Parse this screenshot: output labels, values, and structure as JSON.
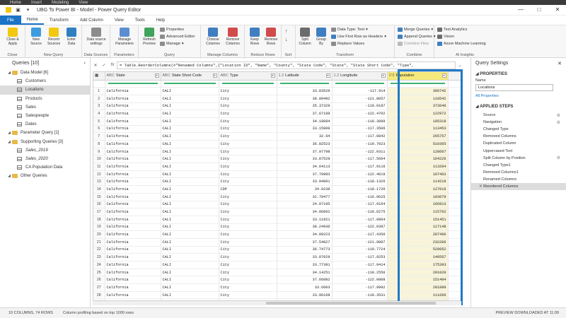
{
  "pbi_menu": [
    "Home",
    "Insert",
    "Modeling",
    "View"
  ],
  "title": "UBG To Power BI - Model - Power Query Editor",
  "tabs": [
    "File",
    "Home",
    "Transform",
    "Add Column",
    "View",
    "Tools",
    "Help"
  ],
  "active_tab": "Home",
  "ribbon": {
    "close": {
      "label": "Close &\nApply",
      "group": "Close"
    },
    "new_query": {
      "new_source": "New\nSource",
      "recent_sources": "Recent\nSources",
      "enter_data": "Enter\nData",
      "group": "New Query"
    },
    "data_sources": {
      "label": "Data source\nsettings",
      "group": "Data Sources"
    },
    "parameters": {
      "label": "Manage\nParameters",
      "group": "Parameters"
    },
    "query": {
      "refresh": "Refresh\nPreview",
      "properties": "Properties",
      "advanced_editor": "Advanced Editor",
      "manage": "Manage",
      "group": "Query"
    },
    "manage_columns": {
      "choose": "Choose\nColumns",
      "remove": "Remove\nColumns",
      "group": "Manage Columns"
    },
    "reduce_rows": {
      "keep": "Keep\nRows",
      "remove": "Remove\nRows",
      "group": "Reduce Rows"
    },
    "sort": {
      "group": "Sort"
    },
    "transform": {
      "split": "Split\nColumn",
      "group_by": "Group\nBy",
      "data_type": "Data Type: Text",
      "first_row": "Use First Row as Headers",
      "replace": "Replace Values",
      "group": "Transform"
    },
    "combine": {
      "merge": "Merge Queries",
      "append": "Append Queries",
      "combine_files": "Combine Files",
      "group": "Combine"
    },
    "ai": {
      "text_analytics": "Text Analytics",
      "vision": "Vision",
      "azure_ml": "Azure Machine Learning",
      "group": "AI Insights"
    }
  },
  "queries": {
    "header": "Queries [10]",
    "items": [
      {
        "label": "Data Model [6]",
        "kind": "folder",
        "indent": 0
      },
      {
        "label": "Customers",
        "kind": "table",
        "indent": 1
      },
      {
        "label": "Locations",
        "kind": "table",
        "indent": 1,
        "selected": true
      },
      {
        "label": "Products",
        "kind": "table",
        "indent": 1
      },
      {
        "label": "Sales",
        "kind": "table",
        "indent": 1
      },
      {
        "label": "Salespeople",
        "kind": "table",
        "indent": 1
      },
      {
        "label": "Dates",
        "kind": "table",
        "indent": 1
      },
      {
        "label": "Parameter Query [1]",
        "kind": "folder",
        "indent": 0
      },
      {
        "label": "Supporting Queries [3]",
        "kind": "folder",
        "indent": 0
      },
      {
        "label": "Sales_2019",
        "kind": "table",
        "indent": 1,
        "italic": true
      },
      {
        "label": "Sales_2020",
        "kind": "table",
        "indent": 1,
        "italic": true
      },
      {
        "label": "CA Population Data",
        "kind": "table",
        "indent": 1
      },
      {
        "label": "Other Queries",
        "kind": "folder",
        "indent": 0
      }
    ]
  },
  "formula": "= Table.ReorderColumns(#\"Renamed Columns\",{\"Location ID\", \"Name\", \"County\", \"State Code\", \"State\", \"State Short Code\", \"Type\",",
  "columns": [
    {
      "name": "State",
      "type": "ABC"
    },
    {
      "name": "State Short Code",
      "type": "ABC"
    },
    {
      "name": "Type",
      "type": "ABC"
    },
    {
      "name": "Latitude",
      "type": "1.2"
    },
    {
      "name": "Longitude",
      "type": "1.2"
    },
    {
      "name": "Population",
      "type": "1²3"
    }
  ],
  "rows": [
    [
      "California",
      "CALI",
      "City",
      "33.83529",
      "-117.914",
      "360742"
    ],
    [
      "California",
      "CALI",
      "City",
      "38.00492",
      "-121.8057",
      "110542"
    ],
    [
      "California",
      "CALI",
      "City",
      "35.37329",
      "-119.0187",
      "373640"
    ],
    [
      "California",
      "CALI",
      "City",
      "37.67189",
      "-122.4702",
      "122972"
    ],
    [
      "California",
      "CALI",
      "City",
      "34.18084",
      "-118.3089",
      "105319"
    ],
    [
      "California",
      "CALI",
      "City",
      "33.15809",
      "-117.3506",
      "113453"
    ],
    [
      "California",
      "CALI",
      "City",
      "32.64",
      "-117.0842",
      "265757"
    ],
    [
      "California",
      "CALI",
      "City",
      "36.82523",
      "-119.7023",
      "510365"
    ],
    [
      "California",
      "CALI",
      "City",
      "37.97798",
      "-122.0311",
      "128667"
    ],
    [
      "California",
      "CALI",
      "City",
      "33.87529",
      "-117.5664",
      "164226"
    ],
    [
      "California",
      "CALI",
      "City",
      "34.64113",
      "-117.9116",
      "113204"
    ],
    [
      "California",
      "CALI",
      "City",
      "37.70883",
      "-122.4619",
      "107463"
    ],
    [
      "California",
      "CALI",
      "City",
      "33.94001",
      "-118.1326",
      "114219"
    ],
    [
      "California",
      "CALI",
      "CDP",
      "34.0238",
      "-118.1720",
      "127016"
    ],
    [
      "California",
      "CALI",
      "City",
      "32.79477",
      "-116.9625",
      "103679"
    ],
    [
      "California",
      "CALI",
      "City",
      "34.07195",
      "-117.9164",
      "166913"
    ],
    [
      "California",
      "CALI",
      "City",
      "34.06862",
      "-118.0275",
      "115762"
    ],
    [
      "California",
      "CALI",
      "City",
      "33.11921",
      "-117.0864",
      "151451"
    ],
    [
      "California",
      "CALI",
      "City",
      "38.24936",
      "-122.0397",
      "117149"
    ],
    [
      "California",
      "CALI",
      "City",
      "34.09223",
      "-117.4350",
      "207460"
    ],
    [
      "California",
      "CALI",
      "City",
      "37.54827",
      "-121.9887",
      "232206"
    ],
    [
      "California",
      "CALI",
      "City",
      "36.74773",
      "-119.7724",
      "520052"
    ],
    [
      "California",
      "CALI",
      "City",
      "33.87029",
      "-117.9253",
      "140567"
    ],
    [
      "California",
      "CALI",
      "City",
      "33.77391",
      "-117.9414",
      "175393"
    ],
    [
      "California",
      "CALI",
      "City",
      "34.14251",
      "-118.2550",
      "201020"
    ],
    [
      "California",
      "CALI",
      "City",
      "37.66882",
      "-122.0808",
      "151494"
    ],
    [
      "California",
      "CALI",
      "City",
      "33.6603",
      "-117.9992",
      "201899"
    ],
    [
      "California",
      "CALI",
      "City",
      "33.96168",
      "-118.3531",
      "111666"
    ],
    [
      "California",
      "CALI",
      "City",
      "33.66946",
      "-117.8231",
      "256927"
    ]
  ],
  "settings": {
    "header": "Query Settings",
    "properties_title": "PROPERTIES",
    "name_label": "Name",
    "name_value": "Locations",
    "all_properties": "All Properties",
    "applied_steps_title": "APPLIED STEPS",
    "steps": [
      {
        "label": "Source",
        "gear": true
      },
      {
        "label": "Navigation",
        "gear": true
      },
      {
        "label": "Changed Type"
      },
      {
        "label": "Removed Columns"
      },
      {
        "label": "Duplicated Column"
      },
      {
        "label": "Uppercased Text"
      },
      {
        "label": "Split Column by Position",
        "gear": true
      },
      {
        "label": "Changed Type1"
      },
      {
        "label": "Removed Columns1"
      },
      {
        "label": "Renamed Columns"
      },
      {
        "label": "Reordered Columns",
        "current": true
      }
    ]
  },
  "status": {
    "columns_rows": "10 COLUMNS, 74 ROWS",
    "profiling": "Column profiling based on top 1000 rows",
    "preview": "PREVIEW DOWNLOADED AT 11:09"
  }
}
